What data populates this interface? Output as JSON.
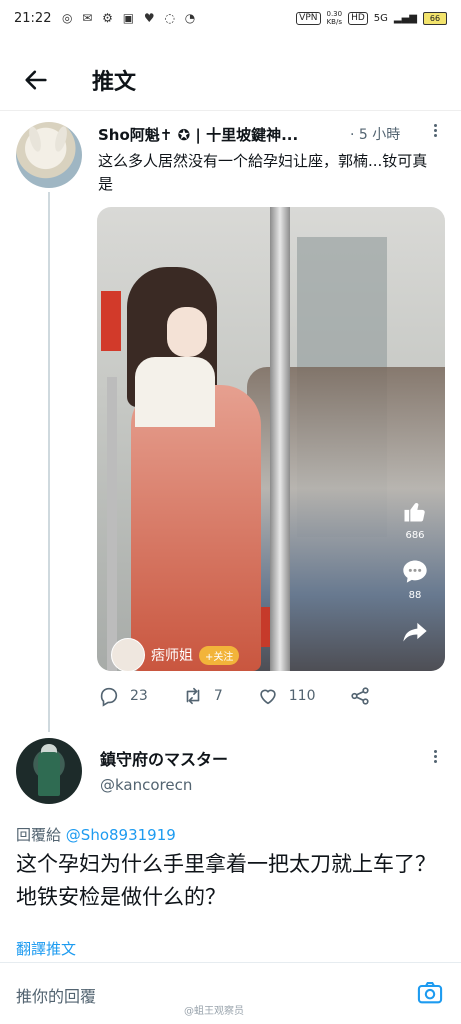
{
  "status_bar": {
    "time": "21:22",
    "left_icons": "◎ ✉ ⚙ ▣ ♥ ◌ ◔",
    "vpn": "VPN",
    "speed_value": "0.30",
    "speed_unit": "KB/s",
    "hd": "HD",
    "network": "5G",
    "battery": "66"
  },
  "header": {
    "title": "推文"
  },
  "tweet1": {
    "name": "Sho阿魁✝ ✪ | 十里坡鍵神...",
    "time": "· 5 小時",
    "text": "这么多人居然没有一个給孕妇让座，郭楠...钕可真是",
    "media": {
      "like_count": "686",
      "comment_count": "88",
      "author": "痞师姐",
      "follow_label": "+关注"
    },
    "actions": {
      "replies": "23",
      "retweets": "7",
      "likes": "110"
    }
  },
  "tweet2": {
    "name": "鎮守府のマスター",
    "handle": "@kancorecn",
    "reply_prefix": "回覆給",
    "reply_handle": "@Sho8931919",
    "text": "这个孕妇为什么手里拿着一把太刀就上车了？地铁安检是做什么的？",
    "translate": "翻譯推文"
  },
  "reply_bar": {
    "placeholder": "推你的回覆"
  },
  "watermark": "@蛆王观察员",
  "colors": {
    "accent": "#1d9bf0",
    "muted": "#536471",
    "text": "#0f1419"
  }
}
